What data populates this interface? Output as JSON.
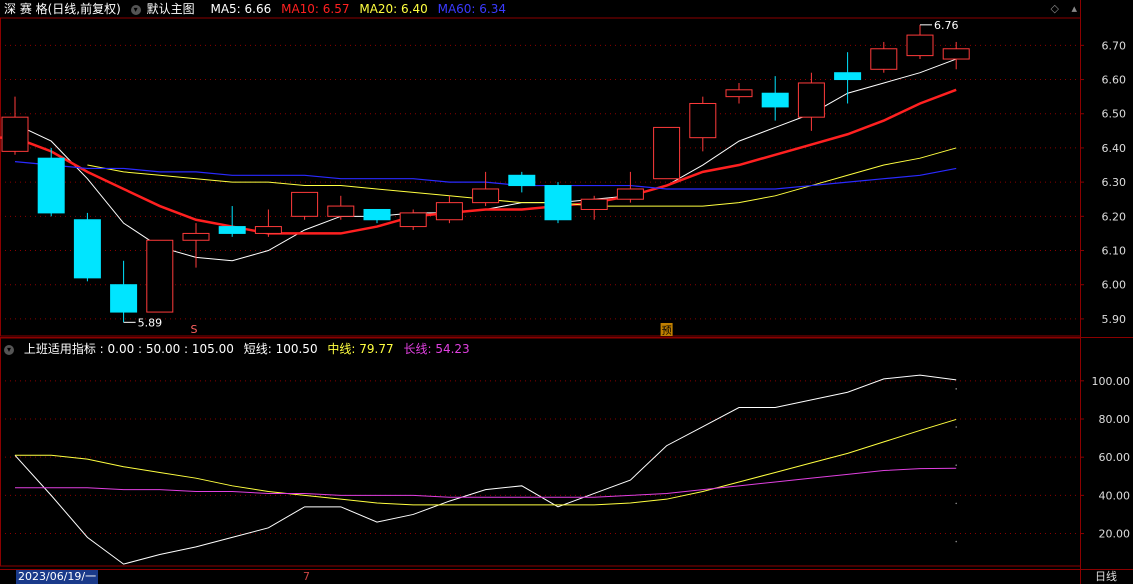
{
  "header_main": {
    "title": "深 赛 格(日线,前复权)",
    "theme": "默认主图",
    "ma5": "MA5: 6.66",
    "ma10": "MA10: 6.57",
    "ma20": "MA20: 6.40",
    "ma60": "MA60: 6.34"
  },
  "header_sub": {
    "title": "上班适用指标 : 0.00 : 50.00 : 105.00",
    "short": "短线: 100.50",
    "mid": "中线: 79.77",
    "long": "长线: 54.23"
  },
  "colors": {
    "up": "#ff3b3b",
    "down": "#00e5ff",
    "ma5": "#ffffff",
    "ma10": "#ff2020",
    "ma20": "#ffff40",
    "ma60": "#2a2aff",
    "short": "#ffffff",
    "mid": "#ffff40",
    "long": "#e040e0",
    "grid": "#8b0000"
  },
  "chart_data": [
    {
      "type": "candlestick",
      "title": "深 赛 格(日线,前复权)",
      "ylim": [
        5.85,
        6.78
      ],
      "y_ticks": [
        "6.70",
        "6.60",
        "6.50",
        "6.40",
        "6.30",
        "6.20",
        "6.10",
        "6.00",
        "5.90"
      ],
      "annotations": {
        "high": "6.76",
        "low": "5.89",
        "marker1": "S",
        "marker2": "预"
      },
      "candles": [
        {
          "o": 6.39,
          "c": 6.49,
          "h": 6.55,
          "l": 6.38
        },
        {
          "o": 6.37,
          "c": 6.21,
          "h": 6.4,
          "l": 6.2
        },
        {
          "o": 6.19,
          "c": 6.02,
          "h": 6.21,
          "l": 6.01
        },
        {
          "o": 6.0,
          "c": 5.92,
          "h": 6.07,
          "l": 5.89
        },
        {
          "o": 5.92,
          "c": 6.13,
          "h": 6.13,
          "l": 5.92
        },
        {
          "o": 6.13,
          "c": 6.15,
          "h": 6.18,
          "l": 6.05
        },
        {
          "o": 6.17,
          "c": 6.15,
          "h": 6.23,
          "l": 6.14
        },
        {
          "o": 6.15,
          "c": 6.17,
          "h": 6.22,
          "l": 6.14
        },
        {
          "o": 6.2,
          "c": 6.27,
          "h": 6.27,
          "l": 6.19
        },
        {
          "o": 6.2,
          "c": 6.23,
          "h": 6.26,
          "l": 6.19
        },
        {
          "o": 6.22,
          "c": 6.19,
          "h": 6.22,
          "l": 6.18
        },
        {
          "o": 6.17,
          "c": 6.21,
          "h": 6.22,
          "l": 6.16
        },
        {
          "o": 6.19,
          "c": 6.24,
          "h": 6.26,
          "l": 6.18
        },
        {
          "o": 6.24,
          "c": 6.28,
          "h": 6.33,
          "l": 6.23
        },
        {
          "o": 6.32,
          "c": 6.29,
          "h": 6.33,
          "l": 6.27
        },
        {
          "o": 6.29,
          "c": 6.19,
          "h": 6.3,
          "l": 6.18
        },
        {
          "o": 6.22,
          "c": 6.25,
          "h": 6.26,
          "l": 6.19
        },
        {
          "o": 6.25,
          "c": 6.28,
          "h": 6.33,
          "l": 6.24
        },
        {
          "o": 6.31,
          "c": 6.46,
          "h": 6.46,
          "l": 6.31
        },
        {
          "o": 6.43,
          "c": 6.53,
          "h": 6.55,
          "l": 6.39
        },
        {
          "o": 6.55,
          "c": 6.57,
          "h": 6.59,
          "l": 6.53
        },
        {
          "o": 6.56,
          "c": 6.52,
          "h": 6.61,
          "l": 6.48
        },
        {
          "o": 6.49,
          "c": 6.59,
          "h": 6.62,
          "l": 6.45
        },
        {
          "o": 6.62,
          "c": 6.6,
          "h": 6.68,
          "l": 6.53
        },
        {
          "o": 6.63,
          "c": 6.69,
          "h": 6.71,
          "l": 6.62
        },
        {
          "o": 6.67,
          "c": 6.73,
          "h": 6.76,
          "l": 6.66
        },
        {
          "o": 6.66,
          "c": 6.69,
          "h": 6.71,
          "l": 6.63
        }
      ],
      "series": [
        {
          "name": "MA5",
          "values": [
            6.47,
            6.42,
            6.31,
            6.18,
            6.11,
            6.08,
            6.07,
            6.1,
            6.16,
            6.2,
            6.2,
            6.21,
            6.21,
            6.22,
            6.24,
            6.24,
            6.25,
            6.26,
            6.29,
            6.35,
            6.42,
            6.46,
            6.5,
            6.56,
            6.59,
            6.62,
            6.66
          ]
        },
        {
          "name": "MA10",
          "values": [
            6.43,
            6.43,
            6.39,
            6.33,
            6.28,
            6.23,
            6.19,
            6.17,
            6.15,
            6.15,
            6.15,
            6.17,
            6.2,
            6.21,
            6.22,
            6.22,
            6.23,
            6.24,
            6.26,
            6.29,
            6.33,
            6.35,
            6.38,
            6.41,
            6.44,
            6.48,
            6.53,
            6.57
          ]
        },
        {
          "name": "MA20",
          "values": [
            6.35,
            6.33,
            6.32,
            6.31,
            6.3,
            6.3,
            6.29,
            6.29,
            6.28,
            6.27,
            6.26,
            6.25,
            6.24,
            6.24,
            6.23,
            6.23,
            6.23,
            6.23,
            6.24,
            6.26,
            6.29,
            6.32,
            6.35,
            6.37,
            6.4
          ]
        },
        {
          "name": "MA60",
          "values": [
            6.36,
            6.35,
            6.34,
            6.34,
            6.33,
            6.33,
            6.32,
            6.32,
            6.32,
            6.31,
            6.31,
            6.31,
            6.3,
            6.3,
            6.29,
            6.29,
            6.29,
            6.29,
            6.28,
            6.28,
            6.28,
            6.28,
            6.29,
            6.3,
            6.31,
            6.32,
            6.34
          ]
        }
      ]
    },
    {
      "type": "line",
      "title": "上班适用指标",
      "ylim": [
        3,
        113
      ],
      "y_ticks": [
        "100.00",
        "80.00",
        "60.00",
        "40.00",
        "20.00"
      ],
      "series": [
        {
          "name": "短线",
          "values": [
            61,
            40,
            18,
            4,
            9,
            13,
            18,
            23,
            34,
            34,
            26,
            30,
            37,
            43,
            45,
            34,
            41,
            48,
            66,
            76,
            86,
            86,
            90,
            94,
            101,
            103,
            100.5
          ]
        },
        {
          "name": "中线",
          "values": [
            61,
            61,
            59,
            55,
            52,
            49,
            45,
            42,
            40,
            38,
            36,
            35,
            35,
            35,
            35,
            35,
            35,
            36,
            38,
            42,
            47,
            52,
            57,
            62,
            68,
            74,
            79.77
          ]
        },
        {
          "name": "长线",
          "values": [
            44,
            44,
            44,
            43,
            43,
            42,
            42,
            41,
            41,
            40,
            40,
            40,
            39,
            39,
            39,
            39,
            39,
            40,
            41,
            43,
            45,
            47,
            49,
            51,
            53,
            54,
            54.23
          ]
        }
      ]
    }
  ],
  "footer": {
    "date": "2023/06/19/一",
    "marker": "7",
    "period": "日线"
  }
}
